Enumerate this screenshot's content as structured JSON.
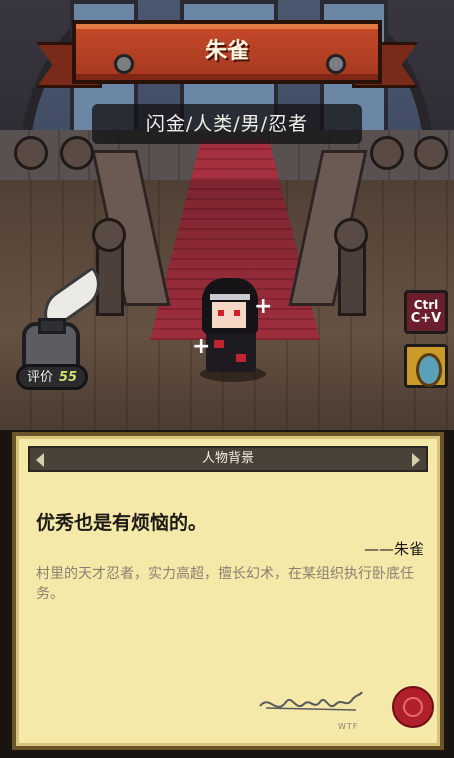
{
  "header": {
    "name": "朱雀",
    "tags": "闪金/人类/男/忍者"
  },
  "rating": {
    "label": "评价",
    "score": "55"
  },
  "side_buttons": {
    "copy_line1": "Ctrl",
    "copy_line2": "C+V"
  },
  "panel": {
    "title": "人物背景",
    "quote": "优秀也是有烦恼的。",
    "quote_author": "——朱雀",
    "description": "村里的天才忍者，实力高超，擅长幻术，在某组织执行卧底任务。",
    "signature_mark": "WTF"
  },
  "colors": {
    "ribbon": "#b4402a",
    "panel_bg": "#f4e9a9",
    "score": "#c9e36b",
    "seal": "#b0202a"
  }
}
